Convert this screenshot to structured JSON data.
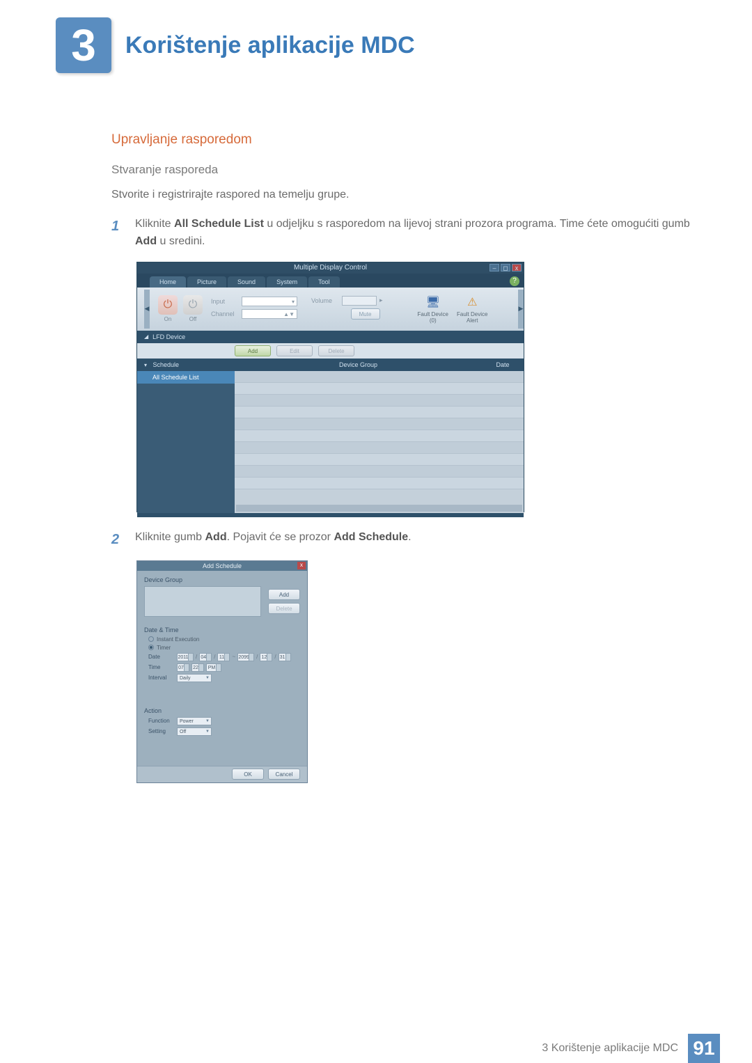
{
  "chapter": {
    "number": "3",
    "title": "Korištenje aplikacije MDC"
  },
  "section": {
    "heading": "Upravljanje rasporedom"
  },
  "subsection": {
    "heading": "Stvaranje rasporeda"
  },
  "intro": "Stvorite i registrirajte raspored na temelju grupe.",
  "steps": [
    {
      "num": "1",
      "pre": "Kliknite ",
      "b1": "All Schedule List",
      "mid": " u odjeljku s rasporedom na lijevoj strani prozora programa. Time ćete omogućiti gumb ",
      "b2": "Add",
      "post": " u sredini."
    },
    {
      "num": "2",
      "pre": "Kliknite gumb ",
      "b1": "Add",
      "mid": ". Pojavit će se prozor ",
      "b2": "Add Schedule",
      "post": "."
    }
  ],
  "mdc": {
    "title": "Multiple Display Control",
    "tabs": {
      "home": "Home",
      "picture": "Picture",
      "sound": "Sound",
      "system": "System",
      "tool": "Tool"
    },
    "help": "?",
    "win": {
      "min": "–",
      "max": "◻",
      "close": "x"
    },
    "power": {
      "on": "On",
      "off": "Off",
      "glyph": "⏻"
    },
    "input_label": "Input",
    "channel_label": "Channel",
    "volume_label": "Volume",
    "mute": "Mute",
    "channel_arrows": "▲▼",
    "input_arrow": "▾",
    "volume_arrow": "▸",
    "fault0": {
      "label": "Fault Device",
      "count": "(0)"
    },
    "fault_alert": {
      "label": "Fault Device",
      "sub": "Alert"
    },
    "nav_left": "◀",
    "nav_right": "▶",
    "lfd": "LFD Device",
    "schedule": "Schedule",
    "all_schedule": "All Schedule List",
    "buttons": {
      "add": "Add",
      "edit": "Edit",
      "delete": "Delete"
    },
    "cols": {
      "group": "Device Group",
      "date": "Date"
    }
  },
  "addsched": {
    "title": "Add Schedule",
    "close": "x",
    "device_group": "Device Group",
    "add": "Add",
    "delete": "Delete",
    "date_time": "Date & Time",
    "instant": "Instant Execution",
    "timer": "Timer",
    "date_label": "Date",
    "time_label": "Time",
    "interval_label": "Interval",
    "date_from": {
      "y": "2011",
      "m": "04",
      "d": "11"
    },
    "tilde": "~",
    "date_to": {
      "y": "2099",
      "m": "12",
      "d": "31"
    },
    "slash": "/",
    "time": {
      "h": "07",
      "m": "22",
      "ap": "PM"
    },
    "interval": "Daily",
    "action": "Action",
    "function_label": "Function",
    "setting_label": "Setting",
    "function": "Power",
    "setting": "Off",
    "ok": "OK",
    "cancel": "Cancel"
  },
  "footer": {
    "text": "3 Korištenje aplikacije MDC",
    "page": "91"
  }
}
